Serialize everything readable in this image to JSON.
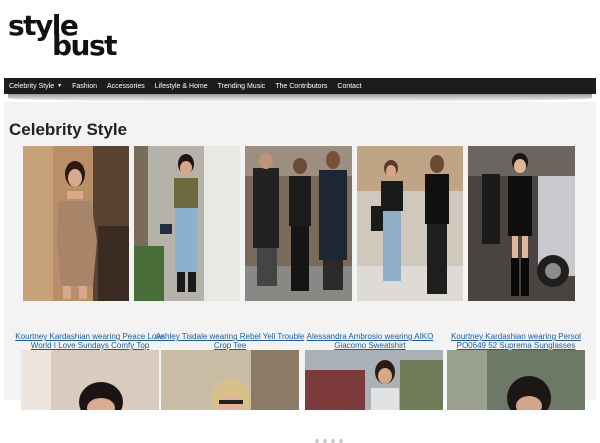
{
  "logo": {
    "line1": "style",
    "line2": "bust"
  },
  "nav": {
    "items": [
      {
        "label": "Celebrity Style",
        "has_dropdown": true
      },
      {
        "label": "Fashion"
      },
      {
        "label": "Accessories"
      },
      {
        "label": "Lifestyle & Home"
      },
      {
        "label": "Trending Music"
      },
      {
        "label": "The Contributors"
      },
      {
        "label": "Contact"
      }
    ]
  },
  "section": {
    "title": "Celebrity Style"
  },
  "slider": {
    "slide_count": 5,
    "active_dot": 0,
    "dot_count": 5
  },
  "articles": [
    {
      "title": "Kourtney Kardashian wearing Peace Love World I Love Sundays Comfy Top"
    },
    {
      "title": "Ashley Tisdale wearing Rebel Yell Trouble Crop Tee"
    },
    {
      "title": "Alessandra Ambrosio wearing AIKO Giacomo Sweatshirt"
    },
    {
      "title": "Kourtney Kardashian wearing Persol PO0649 52 Suprema Sunglasses"
    }
  ],
  "colors": {
    "nav_bg": "#1c1c1c",
    "link": "#1a5d9a",
    "content_bg": "#f3f3f3"
  }
}
